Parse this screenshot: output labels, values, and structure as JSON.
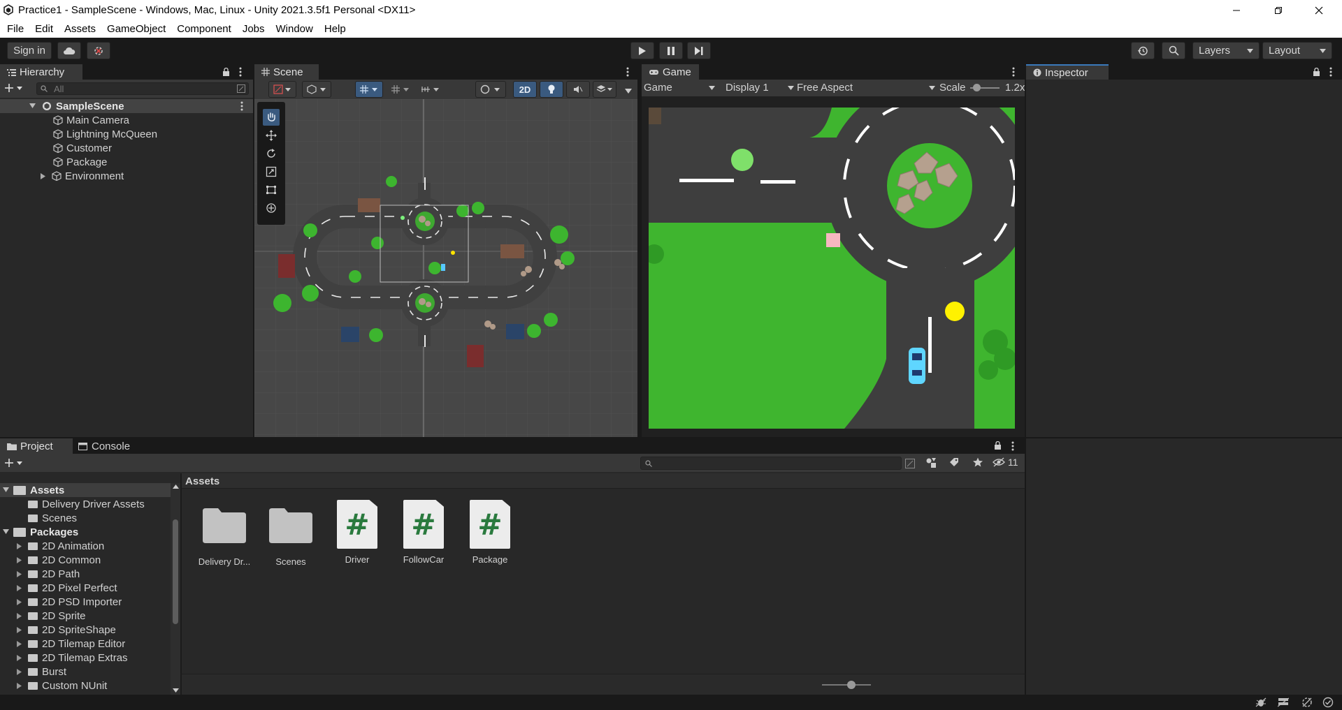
{
  "window": {
    "title": "Practice1 - SampleScene - Windows, Mac, Linux - Unity 2021.3.5f1 Personal <DX11>",
    "minimize_icon": "minimize-icon",
    "restore_icon": "restore-icon",
    "close_icon": "close-icon"
  },
  "menu": [
    "File",
    "Edit",
    "Assets",
    "GameObject",
    "Component",
    "Jobs",
    "Window",
    "Help"
  ],
  "toolbar": {
    "sign_in": "Sign in",
    "layers": "Layers",
    "layout": "Layout"
  },
  "hierarchy": {
    "tab": "Hierarchy",
    "search_placeholder": "All",
    "scene": "SampleScene",
    "items": [
      "Main Camera",
      "Lightning McQueen",
      "Customer",
      "Package",
      "Environment"
    ]
  },
  "scene": {
    "tab": "Scene",
    "mode_2d": "2D"
  },
  "game": {
    "tab": "Game",
    "view_select": "Game",
    "display": "Display 1",
    "aspect": "Free Aspect",
    "scale_label": "Scale",
    "scale_value": "1.2x"
  },
  "inspector": {
    "tab": "Inspector"
  },
  "project": {
    "tab_project": "Project",
    "tab_console": "Console",
    "hidden_count": "11",
    "breadcrumb": "Assets",
    "tree": {
      "assets_root": "Assets",
      "assets_children": [
        "Delivery Driver Assets",
        "Scenes"
      ],
      "packages_root": "Packages",
      "packages_children": [
        "2D Animation",
        "2D Common",
        "2D Path",
        "2D Pixel Perfect",
        "2D PSD Importer",
        "2D Sprite",
        "2D SpriteShape",
        "2D Tilemap Editor",
        "2D Tilemap Extras",
        "Burst",
        "Custom NUnit"
      ]
    },
    "assets": [
      {
        "name": "Delivery Dr...",
        "kind": "folder"
      },
      {
        "name": "Scenes",
        "kind": "folder"
      },
      {
        "name": "Driver",
        "kind": "script"
      },
      {
        "name": "FollowCar",
        "kind": "script"
      },
      {
        "name": "Package",
        "kind": "script"
      }
    ]
  },
  "colors": {
    "grass": "#3fb52f",
    "road": "#3e3e3e",
    "accent": "#3a79bb"
  }
}
